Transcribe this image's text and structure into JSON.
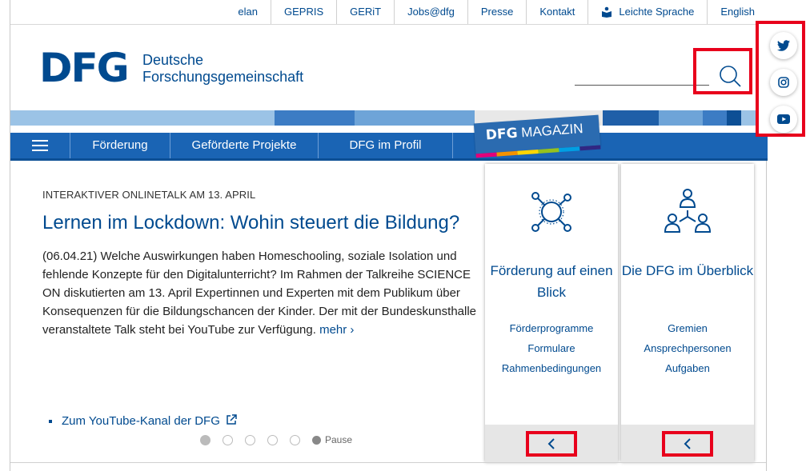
{
  "topbar": {
    "links": [
      "elan",
      "GEPRIS",
      "GERiT",
      "Jobs@dfg",
      "Presse",
      "Kontakt",
      "Leichte Sprache",
      "English"
    ]
  },
  "logo": {
    "mark": "DFG",
    "line1": "Deutsche",
    "line2": "Forschungsgemeinschaft"
  },
  "nav": {
    "items": [
      "Förderung",
      "Geförderte Projekte",
      "DFG im Profil"
    ],
    "magazin_bold": "DFG",
    "magazin_rest": "MAGAZIN"
  },
  "article": {
    "kicker": "INTERAKTIVER ONLINETALK AM 13. APRIL",
    "headline": "Lernen im Lockdown: Wohin steuert die Bildung?",
    "body": "(06.04.21) Welche Auswirkungen haben Homeschooling, soziale Isolation und fehlende Konzepte für den Digitalunterricht? Im Rahmen der Talkreihe SCIENCE ON diskutierten am 13. April Expertinnen und Experten mit dem Publikum über Konsequenzen für die Bildungschancen der Kinder. Der mit der Bundeskunsthalle veranstaltete Talk steht bei YouTube zur Verfügung.",
    "more": "mehr ›",
    "youtube_link": "Zum YouTube-Kanal der DFG",
    "pause": "Pause"
  },
  "cards": [
    {
      "title": "Förderung auf einen Blick",
      "links": [
        "Förderprogramme",
        "Formulare",
        "Rahmenbedingungen"
      ]
    },
    {
      "title": "Die DFG im Überblick",
      "links": [
        "Gremien",
        "Ansprechpersonen",
        "Aufgaben"
      ]
    }
  ],
  "social": [
    "twitter-icon",
    "instagram-icon",
    "youtube-icon"
  ],
  "colors": {
    "brand": "#004a8f",
    "nav": "#1a64b4",
    "highlight": "#e8001c"
  }
}
